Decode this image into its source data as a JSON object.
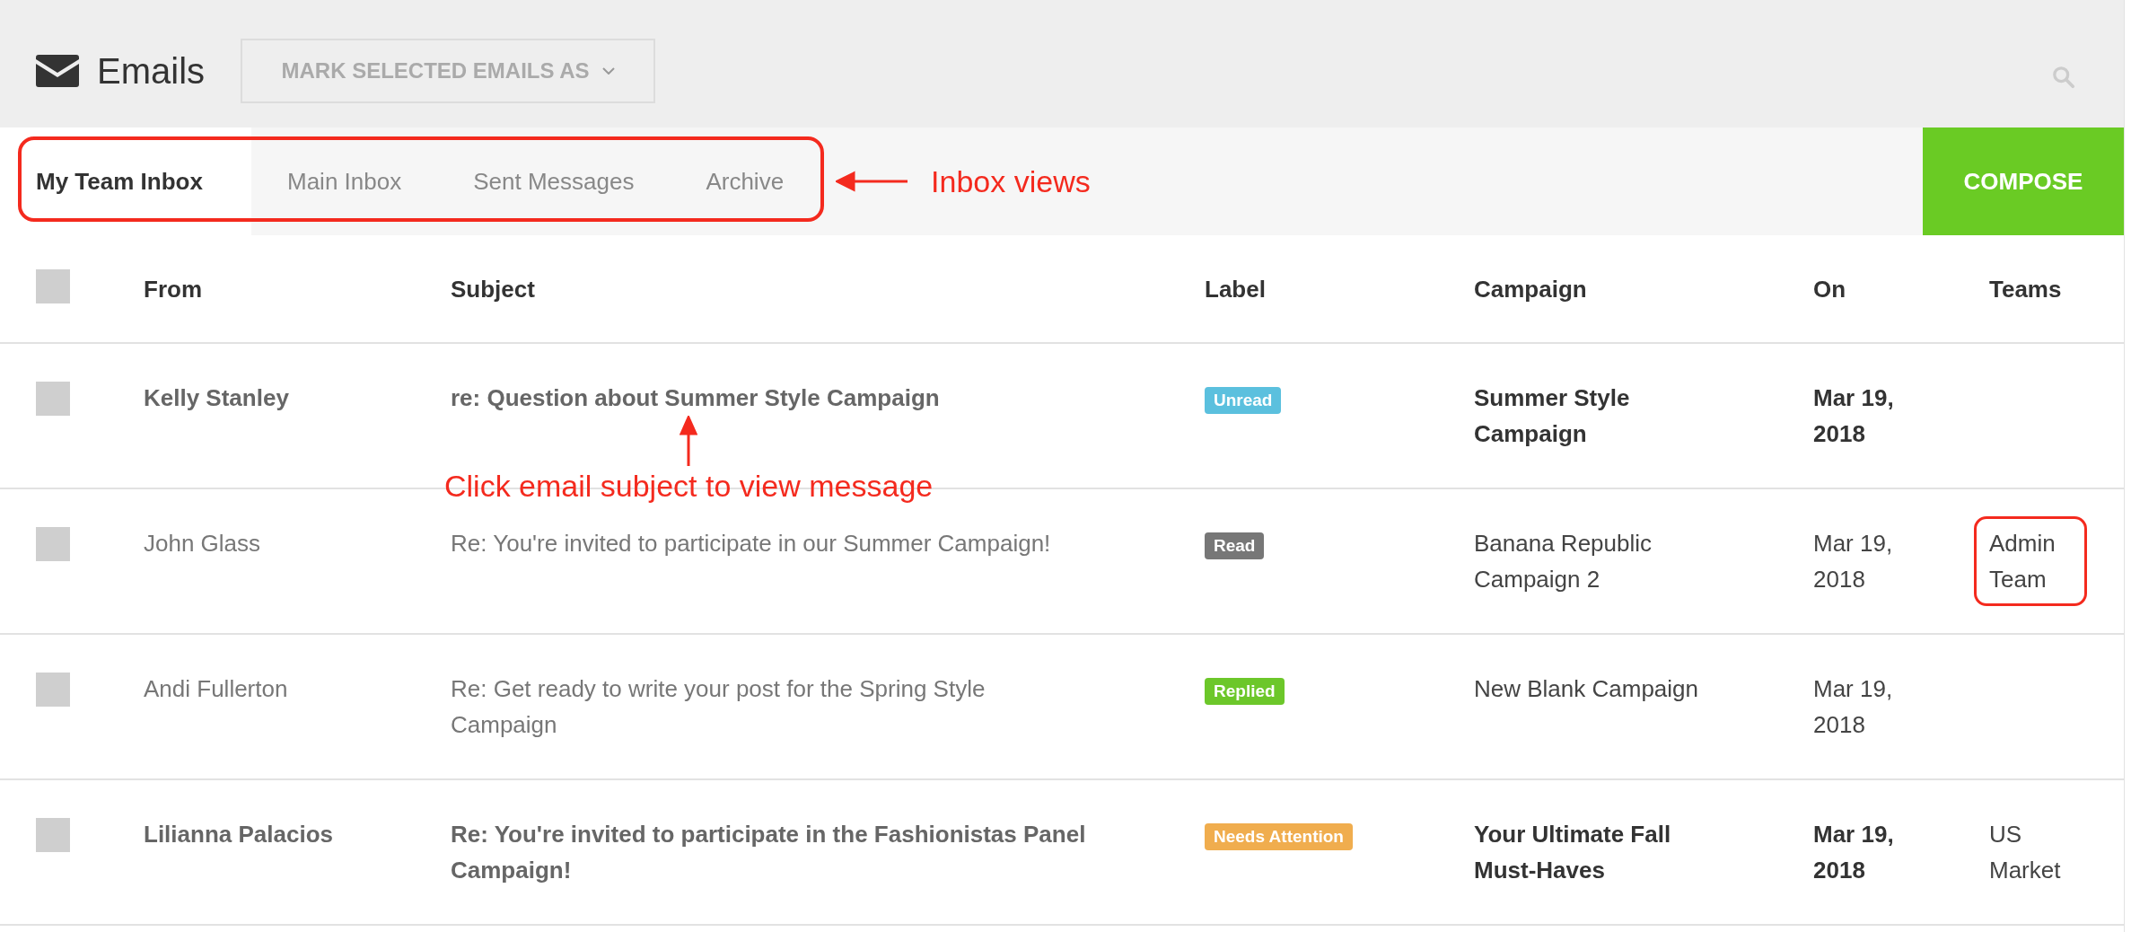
{
  "header": {
    "title": "Emails",
    "mark_button": "MARK SELECTED EMAILS AS"
  },
  "tabs": [
    {
      "label": "My Team Inbox",
      "selected": true
    },
    {
      "label": "Main Inbox",
      "selected": false
    },
    {
      "label": "Sent Messages",
      "selected": false
    },
    {
      "label": "Archive",
      "selected": false
    }
  ],
  "compose_button": "COMPOSE",
  "annotations": {
    "tabs_outlined": true,
    "tabs_note": "Inbox views",
    "subject_note": "Click email subject to view message"
  },
  "table": {
    "select_all_checked": false,
    "columns": [
      "From",
      "Subject",
      "Label",
      "Campaign",
      "On",
      "Teams"
    ],
    "rows": [
      {
        "checked": false,
        "unread": true,
        "from": "Kelly Stanley",
        "subject": "re: Question about Summer Style Campaign",
        "label": {
          "text": "Unread",
          "color": "#5bc0de"
        },
        "campaign": "Summer Style Campaign",
        "on": "Mar 19, 2018"
      },
      {
        "checked": false,
        "unread": false,
        "from": "John Glass",
        "subject": "Re: You're invited to participate in our Summer Campaign!",
        "label": {
          "text": "Read",
          "color": "#777777"
        },
        "campaign": "Banana Republic Campaign 2",
        "on": "Mar 19, 2018",
        "team": {
          "text": "Admin Team",
          "circled": true
        }
      },
      {
        "checked": false,
        "unread": false,
        "from": "Andi Fullerton",
        "subject": "Re: Get ready to write your post for the Spring Style Campaign",
        "label": {
          "text": "Replied",
          "color": "#6cc72a"
        },
        "campaign": "New Blank Campaign",
        "on": "Mar 19, 2018"
      },
      {
        "checked": false,
        "unread": true,
        "from": "Lilianna Palacios",
        "subject": "Re: You're invited to participate in the Fashionistas Panel Campaign!",
        "label": {
          "text": "Needs Attention",
          "color": "#f0ad4e"
        },
        "campaign": "Your Ultimate Fall Must-Haves",
        "on": "Mar 19, 2018",
        "team": {
          "text": "US Market",
          "circled": false
        }
      }
    ]
  }
}
